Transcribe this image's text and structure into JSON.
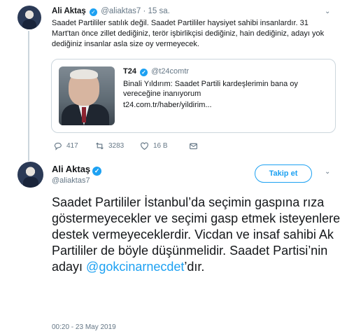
{
  "tweet1": {
    "author_name": "Ali Aktaş",
    "handle": "@aliaktas7",
    "separator": " · ",
    "time": "15 sa.",
    "text": "Saadet Partililer satılık değil. Saadet Partililer haysiyet sahibi insanlardır. 31 Mart'tan önce zillet dediğiniz, terör işbirlikçisi dediğiniz, hain dediğiniz, adayı yok dediğiniz insanlar asla size oy vermeyecek.",
    "card": {
      "source_name": "T24",
      "source_handle": "@t24comtr",
      "description": "Binali Yıldırım: Saadet Partili kardeşlerimin bana oy vereceğine inanıyorum",
      "url": "t24.com.tr/haber/yildirim..."
    },
    "actions": {
      "replies": "417",
      "retweets": "3283",
      "likes": "16 B"
    }
  },
  "tweet2": {
    "author_name": "Ali Aktaş",
    "handle": "@aliaktas7",
    "follow_label": "Takip et",
    "text_main": "Saadet Partililer İstanbul’da seçimin gaspına rıza göstermeyecekler ve seçimi gasp etmek isteyenlere destek vermeyeceklerdir. Vicdan ve insaf sahibi Ak Partililer de böyle düşünmelidir. Saadet Partisi’nin adayı ",
    "mention": "@gokcinarnecdet",
    "text_suffix": "’dır.",
    "timestamp": "00:20 - 23 May 2019"
  },
  "colors": {
    "accent": "#1da1f2",
    "text": "#14171a",
    "secondary": "#657786",
    "border": "#ccd6dd"
  },
  "icons": {
    "reply": "reply-icon",
    "retweet": "retweet-icon",
    "like": "heart-icon",
    "dm": "mail-icon",
    "verified": "verified-badge-icon",
    "more": "chevron-down-icon"
  }
}
